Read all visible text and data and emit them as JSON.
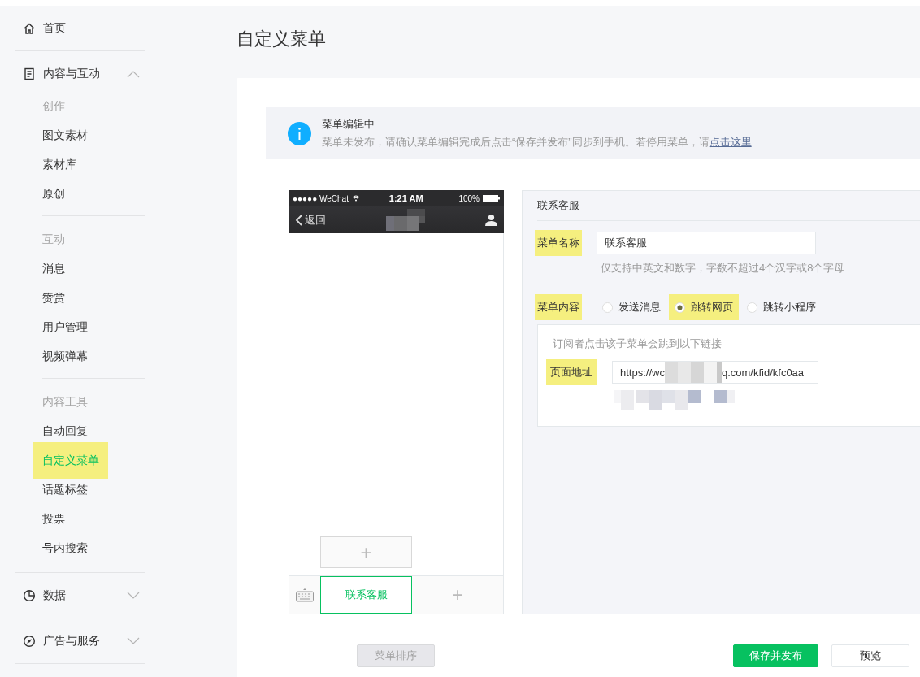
{
  "page_title": "自定义菜单",
  "sidebar": {
    "sections": [
      {
        "kind": "home",
        "label": "首页"
      },
      {
        "kind": "content",
        "label": "内容与互动",
        "expanded": true,
        "groups": [
          {
            "heading": "创作",
            "items": [
              {
                "label": "图文素材",
                "selected": false,
                "highlighted": false
              },
              {
                "label": "素材库",
                "selected": false,
                "highlighted": false
              },
              {
                "label": "原创",
                "selected": false,
                "highlighted": false
              }
            ]
          },
          {
            "heading": "互动",
            "items": [
              {
                "label": "消息",
                "selected": false,
                "highlighted": false
              },
              {
                "label": "赞赏",
                "selected": false,
                "highlighted": false
              },
              {
                "label": "用户管理",
                "selected": false,
                "highlighted": false
              },
              {
                "label": "视频弹幕",
                "selected": false,
                "highlighted": false
              }
            ]
          },
          {
            "heading": "内容工具",
            "items": [
              {
                "label": "自动回复",
                "selected": false,
                "highlighted": false
              },
              {
                "label": "自定义菜单",
                "selected": true,
                "highlighted": true
              },
              {
                "label": "话题标签",
                "selected": false,
                "highlighted": false
              },
              {
                "label": "投票",
                "selected": false,
                "highlighted": false
              },
              {
                "label": "号内搜索",
                "selected": false,
                "highlighted": false
              }
            ]
          }
        ]
      },
      {
        "kind": "data",
        "label": "数据",
        "expanded": false
      },
      {
        "kind": "ads",
        "label": "广告与服务",
        "expanded": false
      }
    ]
  },
  "notice": {
    "title": "菜单编辑中",
    "message": "菜单未发布，请确认菜单编辑完成后点击“保存并发布”同步到手机。若停用菜单，请",
    "link": "点击这里"
  },
  "phone": {
    "status_bar": {
      "carrier": "●●●●● WeChat",
      "time": "1:21 AM",
      "battery": "100%"
    },
    "nav": {
      "back": "返回"
    },
    "submenu": {
      "add": "+"
    },
    "menu": [
      {
        "kind": "item",
        "label": "联系客服",
        "selected": true
      },
      {
        "kind": "add",
        "label": "+"
      }
    ]
  },
  "editor": {
    "heading": "联系客服",
    "name": {
      "label": "菜单名称",
      "highlighted": true,
      "value": "联系客服",
      "hint": "仅支持中英文和数字，字数不超过4个汉字或8个字母"
    },
    "content": {
      "label": "菜单内容",
      "highlighted": true,
      "options": [
        {
          "label": "发送消息",
          "selected": false,
          "highlighted": false
        },
        {
          "label": "跳转网页",
          "selected": true,
          "highlighted": true
        },
        {
          "label": "跳转小程序",
          "selected": false,
          "highlighted": false
        }
      ]
    },
    "link_box": {
      "description": "订阅者点击该子菜单会跳到以下链接",
      "label": "页面地址",
      "highlighted": true,
      "url_start": "https://wc",
      "url_end": "q.com/kfid/kfc0aa"
    }
  },
  "actions": [
    {
      "label": "菜单排序",
      "kind": "disabled"
    },
    {
      "label": "保存并发布",
      "kind": "primary"
    },
    {
      "label": "预览",
      "kind": "default"
    }
  ]
}
